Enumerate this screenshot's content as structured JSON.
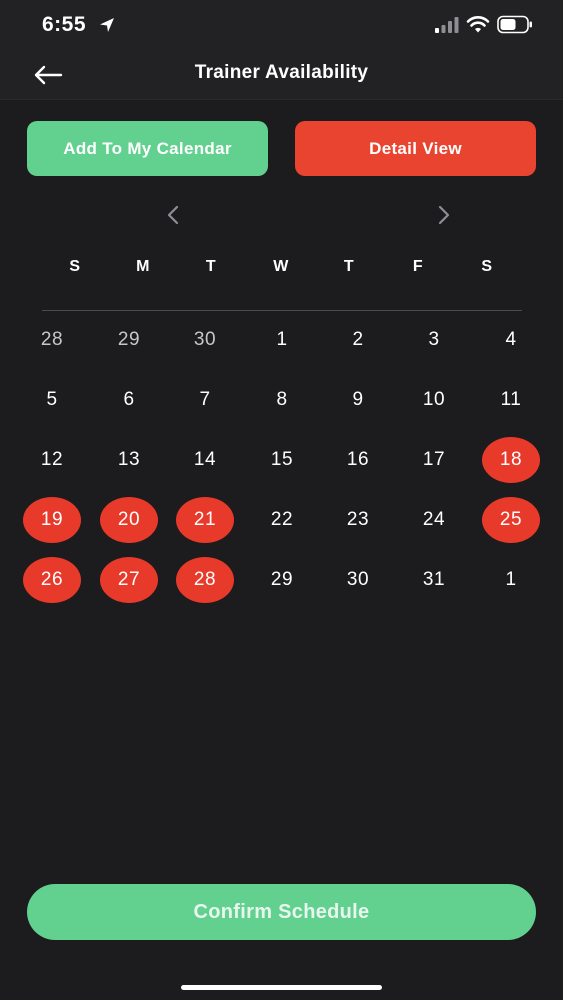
{
  "status_bar": {
    "time": "6:55",
    "icons": [
      "location-arrow-icon",
      "cellular-signal-icon",
      "wifi-icon",
      "battery-icon"
    ]
  },
  "header": {
    "title": "Trainer Availability",
    "back_icon": "arrow-left-icon"
  },
  "actions": {
    "add_calendar_label": "Add To My Calendar",
    "detail_view_label": "Detail View"
  },
  "month_nav": {
    "prev_icon": "chevron-left-icon",
    "next_icon": "chevron-right-icon"
  },
  "calendar": {
    "weekdays": [
      "S",
      "M",
      "T",
      "W",
      "T",
      "F",
      "S"
    ],
    "weeks": [
      [
        {
          "d": "28",
          "muted": true
        },
        {
          "d": "29",
          "muted": true
        },
        {
          "d": "30",
          "muted": true
        },
        {
          "d": "1"
        },
        {
          "d": "2"
        },
        {
          "d": "3"
        },
        {
          "d": "4"
        }
      ],
      [
        {
          "d": "5"
        },
        {
          "d": "6"
        },
        {
          "d": "7"
        },
        {
          "d": "8"
        },
        {
          "d": "9"
        },
        {
          "d": "10"
        },
        {
          "d": "11"
        }
      ],
      [
        {
          "d": "12"
        },
        {
          "d": "13"
        },
        {
          "d": "14"
        },
        {
          "d": "15"
        },
        {
          "d": "16"
        },
        {
          "d": "17"
        },
        {
          "d": "18",
          "available": true
        }
      ],
      [
        {
          "d": "19",
          "available": true
        },
        {
          "d": "20",
          "available": true
        },
        {
          "d": "21",
          "available": true
        },
        {
          "d": "22"
        },
        {
          "d": "23"
        },
        {
          "d": "24"
        },
        {
          "d": "25",
          "available": true
        }
      ],
      [
        {
          "d": "26",
          "available": true
        },
        {
          "d": "27",
          "available": true
        },
        {
          "d": "28",
          "available": true
        },
        {
          "d": "29"
        },
        {
          "d": "30"
        },
        {
          "d": "31"
        },
        {
          "d": "1"
        }
      ]
    ]
  },
  "footer": {
    "confirm_label": "Confirm Schedule"
  },
  "colors": {
    "background": "#1c1b1d",
    "accent_green": "#62d08f",
    "accent_red": "#e84430",
    "available_day": "#e83a2a"
  }
}
